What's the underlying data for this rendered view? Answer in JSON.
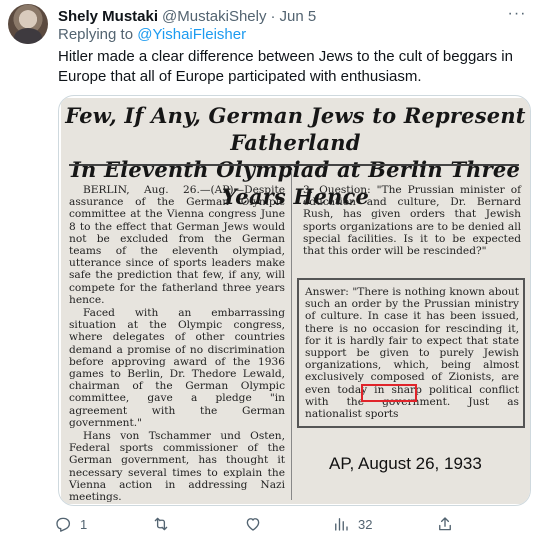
{
  "author": {
    "name": "Shely Mustaki",
    "handle": "@MustakiShely",
    "separator": "·",
    "date": "Jun 5",
    "avatar_icon": "avatar"
  },
  "reply": {
    "prefix": "Replying to",
    "mention": "@YishaiFleisher"
  },
  "tweet_text": "Hitler made a clear difference between Jews to the cult of beggars in Europe that all of Europe participated with enthusiasm.",
  "more_label": "···",
  "clipping": {
    "headline_line1": "Few, If Any, German Jews to Represent Fatherland",
    "headline_line2": "In Eleventh Olympiad at Berlin Three Years Hence",
    "left_column": [
      "BERLIN, Aug. 26.—(AP)—Despite assurance of the German Olympic committee at the Vienna congress June 8 to the effect that German Jews would not be excluded from the German teams of the eleventh olympiad, utterance since of sports leaders make safe the prediction that few, if any, will compete for the fatherland three years hence.",
      "Faced with an embarrassing situation at the Olympic congress, where delegates of other countries demand a promise of no discrimination before approving award of the 1936 games to Berlin, Dr. Thedore Lewald, chairman of the German Olympic committee, gave a pledge \"in agreement with the German government.\"",
      "Hans von Tschammer und Osten, Federal sports commissioner of the German government, has thought it necessary several times to explain the Vienna action in addressing Nazi meetings."
    ],
    "right_question": "3. Question: \"The Prussian minister of education and culture, Dr. Bernard Rush, has given orders that Jewish sports organizations are to be denied all special facilities. Is it to be expected that this order will be rescinded?\"",
    "right_answer": "Answer: \"There is nothing known about such an order by the Prussian ministry of culture. In case it has been issued, there is no occasion for rescinding it, for it is hardly fair to expect that state support be given to purely Jewish organizations, which, being almost exclusively composed of Zionists, are even today in sharp political conflict with the government. Just as nationalist sports",
    "caption": "AP, August 26, 1933"
  },
  "actions": {
    "reply_count": "1",
    "retweet_count": "",
    "like_count": "",
    "views_count": "32",
    "icons": [
      "reply-icon",
      "retweet-icon",
      "like-icon",
      "views-icon",
      "share-icon"
    ]
  },
  "colors": {
    "link": "#1d9bf0",
    "muted": "#536471",
    "text": "#0f1419",
    "highlight_box": "#e0242a"
  }
}
